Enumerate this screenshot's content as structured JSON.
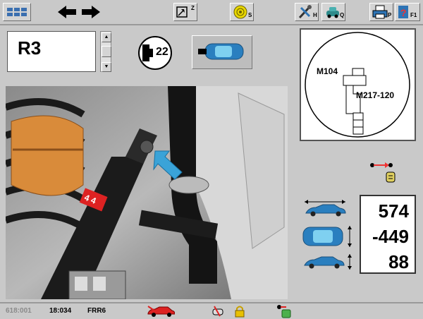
{
  "toolbar": {
    "buttons": [
      {
        "name": "menu-grid-icon",
        "sup": ""
      },
      {
        "name": "back-arrow-icon",
        "sup": ""
      },
      {
        "name": "forward-arrow-icon",
        "sup": ""
      },
      {
        "name": "zoom-icon",
        "sup": "Z"
      },
      {
        "name": "speaker-icon",
        "sup": "S"
      },
      {
        "name": "tools-icon",
        "sup": "H"
      },
      {
        "name": "search-car-icon",
        "sup": "Q"
      },
      {
        "name": "print-icon",
        "sup": "P"
      },
      {
        "name": "help-icon",
        "sup": "F1"
      }
    ]
  },
  "main": {
    "code": "R3",
    "torque_number": "22"
  },
  "tool_diagram": {
    "label_1": "M104",
    "label_2": "M217-120"
  },
  "measurements": {
    "values": [
      "574",
      "-449",
      "88"
    ]
  },
  "status": {
    "item1": "618:001",
    "item2": "18:034",
    "item3": "FRR6"
  },
  "colors": {
    "accent_blue": "#3aa3d8",
    "panel_gray": "#c9c9c9"
  }
}
